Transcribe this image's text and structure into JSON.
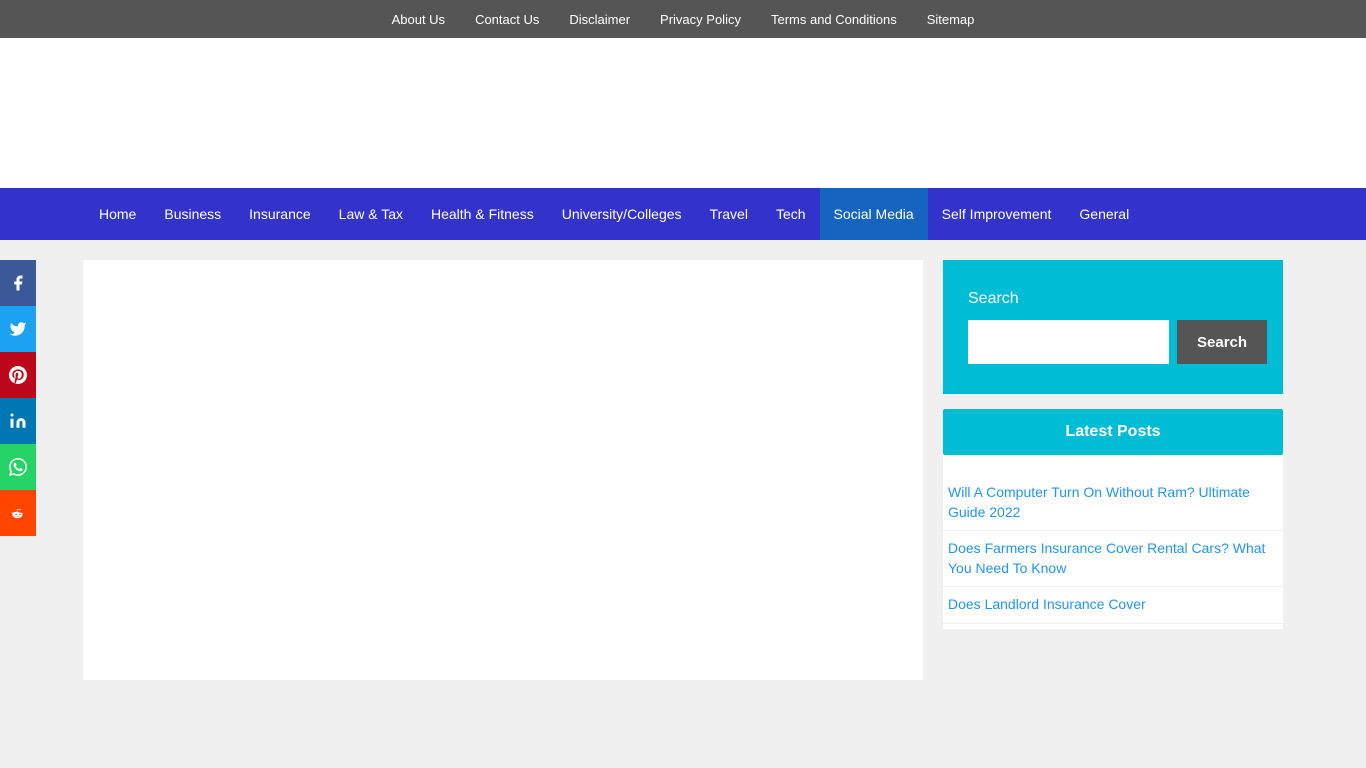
{
  "topbar": {
    "links": [
      {
        "label": "About Us",
        "href": "#"
      },
      {
        "label": "Contact Us",
        "href": "#"
      },
      {
        "label": "Disclaimer",
        "href": "#"
      },
      {
        "label": "Privacy Policy",
        "href": "#"
      },
      {
        "label": "Terms and Conditions",
        "href": "#"
      },
      {
        "label": "Sitemap",
        "href": "#"
      }
    ]
  },
  "nav": {
    "items": [
      {
        "label": "Home",
        "active": false
      },
      {
        "label": "Business",
        "active": false
      },
      {
        "label": "Insurance",
        "active": false
      },
      {
        "label": "Law & Tax",
        "active": false
      },
      {
        "label": "Health & Fitness",
        "active": false
      },
      {
        "label": "University/Colleges",
        "active": false
      },
      {
        "label": "Travel",
        "active": false
      },
      {
        "label": "Tech",
        "active": false
      },
      {
        "label": "Social Media",
        "active": true
      },
      {
        "label": "Self Improvement",
        "active": false
      },
      {
        "label": "General",
        "active": false
      }
    ]
  },
  "sidebar": {
    "search": {
      "label": "Search",
      "button_label": "Search",
      "placeholder": ""
    },
    "latest_posts": {
      "header": "Latest Posts",
      "items": [
        {
          "title": "Will A Computer Turn On Without Ram? Ultimate Guide 2022",
          "href": "#"
        },
        {
          "title": "Does Farmers Insurance Cover Rental Cars? What You Need To Know",
          "href": "#"
        },
        {
          "title": "Does Landlord Insurance Cover",
          "href": "#"
        }
      ]
    }
  },
  "social": {
    "buttons": [
      {
        "name": "facebook",
        "icon": "f",
        "class": "fb"
      },
      {
        "name": "twitter",
        "icon": "t",
        "class": "tw"
      },
      {
        "name": "pinterest",
        "icon": "p",
        "class": "pi"
      },
      {
        "name": "linkedin",
        "icon": "in",
        "class": "li"
      },
      {
        "name": "whatsapp",
        "icon": "w",
        "class": "wa"
      },
      {
        "name": "reddit",
        "icon": "r",
        "class": "rd"
      }
    ]
  }
}
